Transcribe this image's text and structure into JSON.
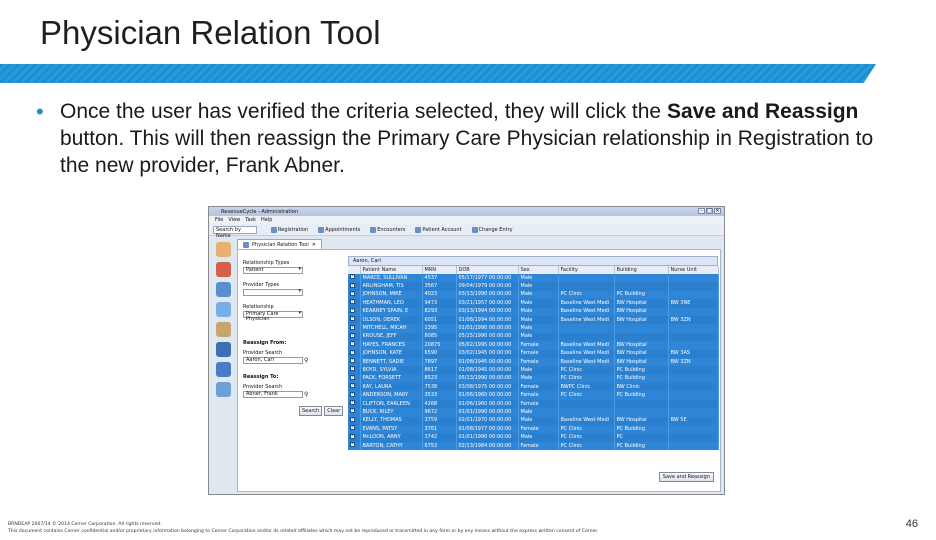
{
  "slide": {
    "title": "Physician Relation Tool",
    "bullet_pre": "Once the user has verified the criteria selected, they will click the ",
    "bullet_bold": "Save and Reassign",
    "bullet_post": " button. This will then reassign the Primary Care Physician relationship in Registration to the new provider, Frank Abner.",
    "page_number": "46",
    "footer_line1": "BRNDEAP 2007/14   © 2014 Cerner Corporation. All rights reserved.",
    "footer_line2": "This document contains Cerner confidential and/or proprietary information belonging to Cerner Corporation and/or its related affiliates which may not be reproduced or transmitted in any form or by any means without the express written consent of Cerner.",
    "accent_color": "#1c8fd0"
  },
  "app": {
    "window_title": "RevenueCycle - Administration",
    "menu": [
      "File",
      "View",
      "Task",
      "Help"
    ],
    "search_placeholder": "Search by Name",
    "toolbar": [
      "Registration",
      "Appointments",
      "Encounters",
      "Patient Account",
      "Change Entry"
    ],
    "tab_label": "Physician Relation Tool",
    "tab_close": "✕",
    "filters": {
      "relationship_types_label": "Relationship Types",
      "relationship_value": "Patient",
      "provider_types_label": "Provider Types",
      "provider_types_value": "",
      "relationship_label": "Relationship",
      "relationship_type_value": "Primary Care Physician",
      "reassign_from_label": "Reassign From:",
      "provider_search_label": "Provider Search",
      "from_value": "Aaron, Carl",
      "reassign_to_label": "Reassign To:",
      "provider_search_label2": "Provider Search",
      "to_value": "Abner, Frank",
      "search_button": "Search",
      "clear_button": "Clear"
    },
    "grid": {
      "title": "Aaron, Carl",
      "columns": [
        "",
        "Patient Name",
        "MRN",
        "DOB",
        "Sex",
        "Facility",
        "Building",
        "Nurse Unit"
      ],
      "rows": [
        [
          "MARCE, SULLIVAN",
          "4537",
          "05/17/1977 00:00:00",
          "Male",
          "",
          "",
          ""
        ],
        [
          "ARLINGHAM, TIS",
          "3567",
          "09/04/1979 00:00:00",
          "Male",
          "",
          "",
          ""
        ],
        [
          "JOHNSON, MIKE",
          "4023",
          "03/13/1990 00:00:00",
          "Male",
          "PC Clinic",
          "PC Building",
          ""
        ],
        [
          "HEATHMAN, LEO",
          "9473",
          "03/21/1957 00:00:00",
          "Male",
          "Baseline West Medi",
          "BW Hospital",
          "BW 3NE"
        ],
        [
          "KEARNEY SPAIN, E",
          "8293",
          "03/13/1994 00:00:00",
          "Male",
          "Baseline West Medi",
          "BW Hospital",
          ""
        ],
        [
          "OLSON, DEREK",
          "6051",
          "01/08/1994 00:00:00",
          "Male",
          "Baseline West Medi",
          "BW Hospital",
          "BW 3ZN"
        ],
        [
          "MITCHELL, MICAH",
          "1395",
          "01/01/1990 00:00:00",
          "Male",
          "",
          "",
          ""
        ],
        [
          "KROUSE, JEFF",
          "8085",
          "05/15/1990 00:00:00",
          "Male",
          "",
          "",
          ""
        ],
        [
          "HAYES, FRANCES",
          "20875",
          "05/02/1995 00:00:00",
          "Female",
          "Baseline West Medi",
          "BW Hospital",
          ""
        ],
        [
          "JOHNSON, KATE",
          "6590",
          "03/02/1945 00:00:00",
          "Female",
          "Baseline West Medi",
          "BW Hospital",
          "BW 3AS"
        ],
        [
          "BENNETT, SADIE",
          "7897",
          "01/08/1945 00:00:00",
          "Female",
          "Baseline West Medi",
          "BW Hospital",
          "BW 3ZN"
        ],
        [
          "BOYD, SYLVIA",
          "8617",
          "01/08/1945 00:00:00",
          "Male",
          "PC Clinic",
          "PC Building",
          ""
        ],
        [
          "PACK, FORSETT",
          "8523",
          "05/13/1990 00:00:00",
          "Male",
          "PC Clinic",
          "PC Building",
          ""
        ],
        [
          "KAY, LAURA",
          "7538",
          "03/08/1975 00:00:00",
          "Female",
          "BWPC Clinic",
          "BW Clinic",
          ""
        ],
        [
          "ANDERSON, MARY",
          "3533",
          "01/06/1960 00:00:00",
          "Female",
          "PC Clinic",
          "PC Building",
          ""
        ],
        [
          "CLIFTON, EARLEEN",
          "4268",
          "01/06/1960 00:00:00",
          "Female",
          "",
          "",
          ""
        ],
        [
          "BUCK, RILEY",
          "9672",
          "01/01/1990 00:00:00",
          "Male",
          "",
          "",
          ""
        ],
        [
          "KELLY, THOMAS",
          "3759",
          "02/01/1970 00:00:00",
          "Male",
          "Baseline West Medi",
          "BW Hospital",
          "BW 5E"
        ],
        [
          "EVANS, PATSY",
          "3761",
          "01/08/1977 00:00:00",
          "Female",
          "PC Clinic",
          "PC Building",
          ""
        ],
        [
          "McLOON, ARNY",
          "3742",
          "01/01/1990 00:00:00",
          "Male",
          "PC Clinic",
          "PC",
          ""
        ],
        [
          "BARTON, CATHY",
          "6753",
          "02/13/1984 00:00:00",
          "Female",
          "PC Clinic",
          "PC Building",
          ""
        ]
      ],
      "save_button": "Save and Reassign"
    }
  }
}
